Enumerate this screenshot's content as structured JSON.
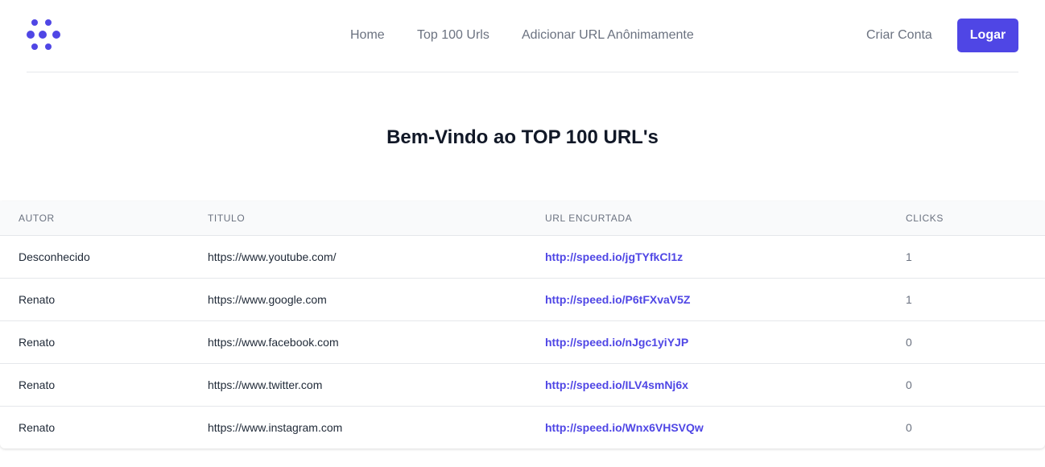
{
  "header": {
    "logo_icon": "network-dots-icon",
    "accent_color": "#4f46e5",
    "nav": {
      "home": "Home",
      "top": "Top 100 Urls",
      "anon": "Adicionar URL Anônimamente"
    },
    "signup": "Criar Conta",
    "login": "Logar"
  },
  "main": {
    "title": "Bem-Vindo ao TOP 100 URL's"
  },
  "table": {
    "headers": {
      "author": "AUTOR",
      "title": "TITULO",
      "short_url": "URL ENCURTADA",
      "clicks": "CLICKS"
    },
    "rows": [
      {
        "author": "Desconhecido",
        "title": "https://www.youtube.com/",
        "short_url": "http://speed.io/jgTYfkCl1z",
        "clicks": "1"
      },
      {
        "author": "Renato",
        "title": "https://www.google.com",
        "short_url": "http://speed.io/P6tFXvaV5Z",
        "clicks": "1"
      },
      {
        "author": "Renato",
        "title": "https://www.facebook.com",
        "short_url": "http://speed.io/nJgc1yiYJP",
        "clicks": "0"
      },
      {
        "author": "Renato",
        "title": "https://www.twitter.com",
        "short_url": "http://speed.io/ILV4smNj6x",
        "clicks": "0"
      },
      {
        "author": "Renato",
        "title": "https://www.instagram.com",
        "short_url": "http://speed.io/Wnx6VHSVQw",
        "clicks": "0"
      }
    ]
  }
}
